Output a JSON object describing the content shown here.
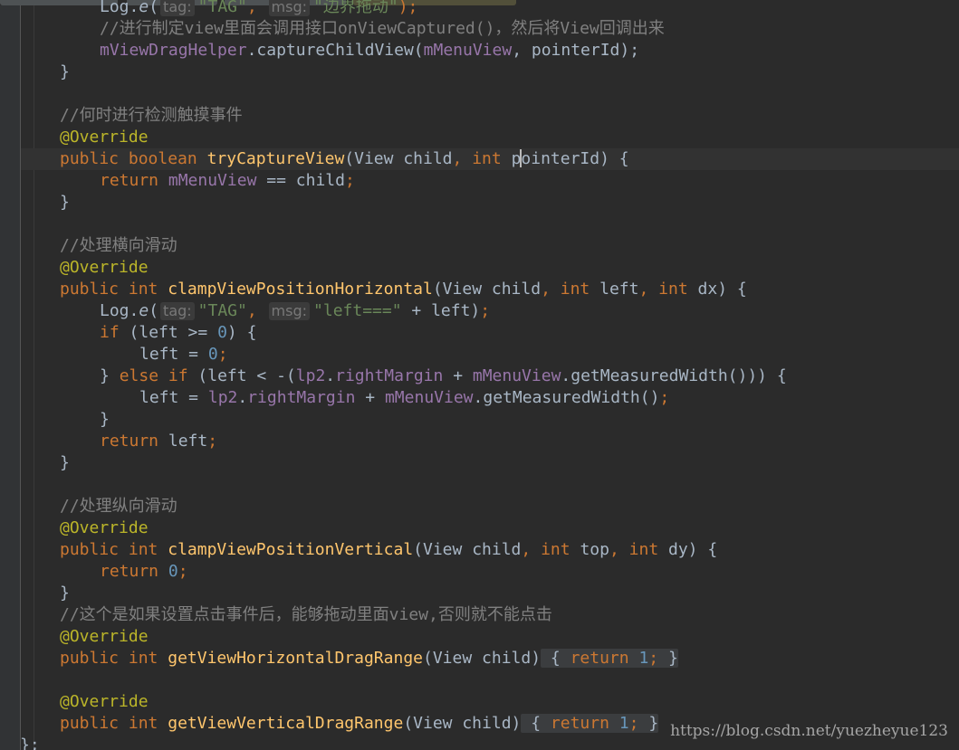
{
  "editor": {
    "lines": [
      {
        "top": "log_partial",
        "parts": [
          "Log.",
          "e",
          "(",
          "tag:",
          "\"TAG\"",
          ",",
          "msg:",
          "\"边界拖动\"",
          ");"
        ]
      },
      {
        "comment": "//进行制定view里面会调用接口onViewCaptured()，然后将View回调出来"
      },
      {
        "parts": [
          "mViewDragHelper",
          ".captureChildView(",
          "mMenuView",
          ", pointerId",
          ");"
        ]
      },
      {
        "text": "}"
      },
      {
        "comment": "//何时进行检测触摸事件"
      },
      {
        "annotation": "@Override"
      },
      {
        "parts": [
          "public",
          "boolean",
          "tryCaptureView",
          "(View child",
          ",",
          "int",
          "p",
          "ointerId) {"
        ]
      },
      {
        "parts": [
          "return",
          "mMenuView",
          "== child",
          ";"
        ]
      },
      {
        "text": "}"
      },
      {
        "comment": "//处理横向滑动"
      },
      {
        "annotation": "@Override"
      },
      {
        "parts": [
          "public",
          "int",
          "clampViewPositionHorizontal",
          "(View child",
          ",",
          "int",
          "left",
          ",",
          "int",
          "dx) {"
        ]
      },
      {
        "parts": [
          "Log.",
          "e",
          "(",
          "tag:",
          "\"TAG\"",
          ",",
          "msg:",
          "\"left===\"",
          " + left)",
          ";"
        ]
      },
      {
        "parts": [
          "if",
          "(left >= ",
          "0",
          ") {"
        ]
      },
      {
        "parts": [
          "left = ",
          "0",
          ";"
        ]
      },
      {
        "parts": [
          "} ",
          "else if",
          "(left < -(",
          "lp2",
          ".",
          "rightMargin",
          "+ ",
          "mMenuView",
          ".getMeasuredWidth())) {"
        ]
      },
      {
        "parts": [
          "left = ",
          "lp2",
          ".",
          "rightMargin",
          "+ ",
          "mMenuView",
          ".getMeasuredWidth()",
          ";"
        ]
      },
      {
        "text": "}"
      },
      {
        "parts": [
          "return",
          "left",
          ";"
        ]
      },
      {
        "text": "}"
      },
      {
        "comment": "//处理纵向滑动"
      },
      {
        "annotation": "@Override"
      },
      {
        "parts": [
          "public",
          "int",
          "clampViewPositionVertical",
          "(View child",
          ",",
          "int",
          "top",
          ",",
          "int",
          "dy) {"
        ]
      },
      {
        "parts": [
          "return",
          "0",
          ";"
        ]
      },
      {
        "text": "}"
      },
      {
        "comment": "//这个是如果设置点击事件后，能够拖动里面view,否则就不能点击"
      },
      {
        "annotation": "@Override"
      },
      {
        "parts": [
          "public",
          "int",
          "getViewHorizontalDragRange",
          "(View child)",
          "{",
          "return",
          "1",
          ";",
          "}"
        ]
      },
      {
        "annotation": "@Override"
      },
      {
        "parts": [
          "public",
          "int",
          "getViewVerticalDragRange",
          "(View child)",
          "{",
          "return",
          "1",
          ";",
          "}"
        ]
      },
      {
        "text": "};"
      }
    ]
  },
  "watermark": "https://blog.csdn.net/yuezheyue123",
  "colors": {
    "background": "#2b2b2b",
    "keyword": "#cc7832",
    "function": "#ffc66d",
    "field": "#9876aa",
    "string": "#6a8759",
    "number": "#6897bb",
    "comment": "#808080",
    "annotation": "#bbb529",
    "text": "#a9b7c6"
  }
}
